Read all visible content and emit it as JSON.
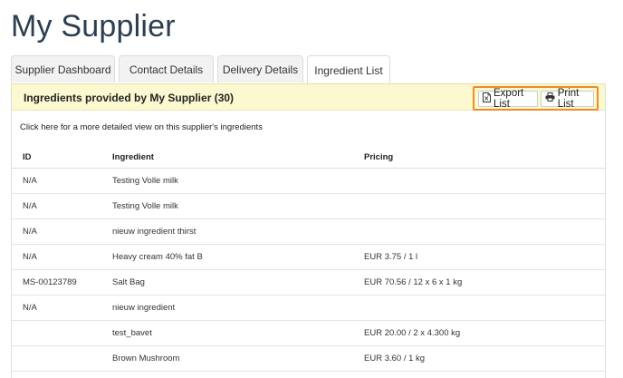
{
  "page": {
    "title": "My Supplier"
  },
  "tabs": [
    {
      "label": "Supplier Dashboard",
      "active": false
    },
    {
      "label": "Contact Details",
      "active": false
    },
    {
      "label": "Delivery Details",
      "active": false
    },
    {
      "label": "Ingredient List",
      "active": true
    }
  ],
  "panel": {
    "heading": "Ingredients provided by My Supplier (30)",
    "export_label": "Export List",
    "print_label": "Print List",
    "export_icon": "file-export-icon",
    "print_icon": "printer-icon",
    "detail_link": "Click here for a more detailed view on this supplier's ingredients"
  },
  "table": {
    "headers": {
      "id": "ID",
      "ingredient": "Ingredient",
      "pricing": "Pricing"
    },
    "rows": [
      {
        "id": "N/A",
        "ingredient": "Testing Volle milk",
        "pricing": ""
      },
      {
        "id": "N/A",
        "ingredient": "Testing Volle milk",
        "pricing": ""
      },
      {
        "id": "N/A",
        "ingredient": "nieuw ingredient thirst",
        "pricing": ""
      },
      {
        "id": "N/A",
        "ingredient": "Heavy cream 40% fat B",
        "pricing": "EUR 3.75 / 1 l"
      },
      {
        "id": "MS-00123789",
        "ingredient": "Salt Bag",
        "pricing": "EUR 70.56 / 12 x 6 x 1 kg"
      },
      {
        "id": "N/A",
        "ingredient": "nieuw ingredient",
        "pricing": ""
      },
      {
        "id": "",
        "ingredient": "test_bavet",
        "pricing": "EUR 20.00 / 2 x 4.300 kg"
      },
      {
        "id": "",
        "ingredient": "Brown Mushroom",
        "pricing": "EUR 3.60 / 1 kg"
      }
    ]
  },
  "colors": {
    "header_bg": "#fcf8d0",
    "highlight_border": "#f08b2c",
    "title_color": "#2c3e50"
  }
}
